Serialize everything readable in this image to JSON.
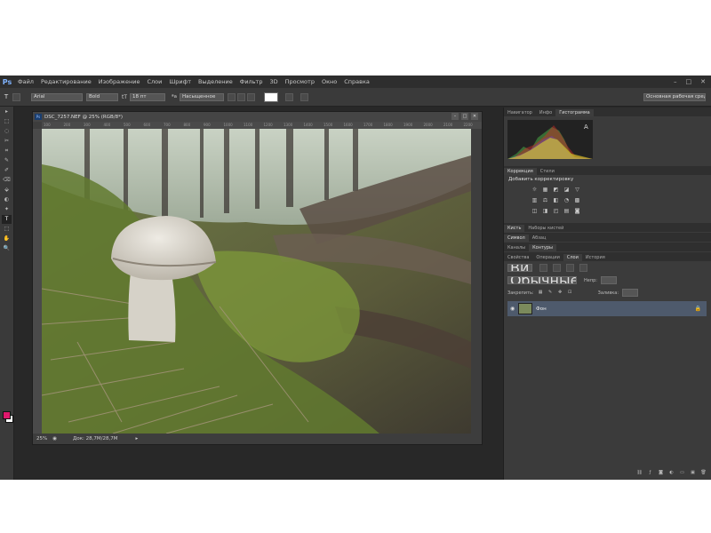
{
  "app": {
    "logo": "Ps",
    "menu": [
      "Файл",
      "Редактирование",
      "Изображение",
      "Слои",
      "Шрифт",
      "Выделение",
      "Фильтр",
      "3D",
      "Просмотр",
      "Окно",
      "Справка"
    ],
    "window_controls": [
      "–",
      "□",
      "✕"
    ]
  },
  "options": {
    "font_family": "Arial",
    "font_style": "Bold",
    "font_size": "18 пт",
    "aa_label": "ªa",
    "antialias": "Насыщенное",
    "workspace": "Основная рабочая среда"
  },
  "tools": [
    "▸",
    "⬚",
    "◌",
    "✂",
    "⌗",
    "✎",
    "✐",
    "⌫",
    "⬙",
    "◐",
    "✦",
    "T",
    "⬚",
    "✋",
    "🔍"
  ],
  "document": {
    "tab_title": "DSC_7257.NEF @ 25% (RGB/8*)",
    "ps_badge": "Ps",
    "ruler_ticks": [
      "100",
      "200",
      "300",
      "400",
      "500",
      "600",
      "700",
      "800",
      "900",
      "1000",
      "1100",
      "1200",
      "1300",
      "1400",
      "1500",
      "1600",
      "1700",
      "1800",
      "1900",
      "2000",
      "2100",
      "2200"
    ],
    "zoom": "25%",
    "doc_size": "Док: 28,7M/28,7M"
  },
  "panels": {
    "top_tabs": [
      "Навигатор",
      "Инфо",
      "Гистограмма"
    ],
    "adj_tabs": [
      "Коррекция",
      "Стили"
    ],
    "adj_title": "Добавить корректировку",
    "adj_icons": [
      "☼",
      "▦",
      "◩",
      "◪",
      "▽",
      "▥",
      "⚖",
      "◧",
      "◔",
      "▩",
      "◫",
      "◨",
      "◰",
      "▤",
      "◙"
    ],
    "brush_tabs": [
      "Кисть",
      "Наборы кистей"
    ],
    "char_tabs": [
      "Символ",
      "Абзац"
    ],
    "channel_tabs": [
      "Каналы",
      "Контуры"
    ],
    "layer_tabs": [
      "Свойства",
      "Операции",
      "Слои",
      "История"
    ],
    "layer_kind": "Вид",
    "blend_mode": "Обычные",
    "opacity_label": "Непр:",
    "lock_label": "Закрепить:",
    "fill_label": "Заливка:",
    "layer_name": "Фон"
  }
}
